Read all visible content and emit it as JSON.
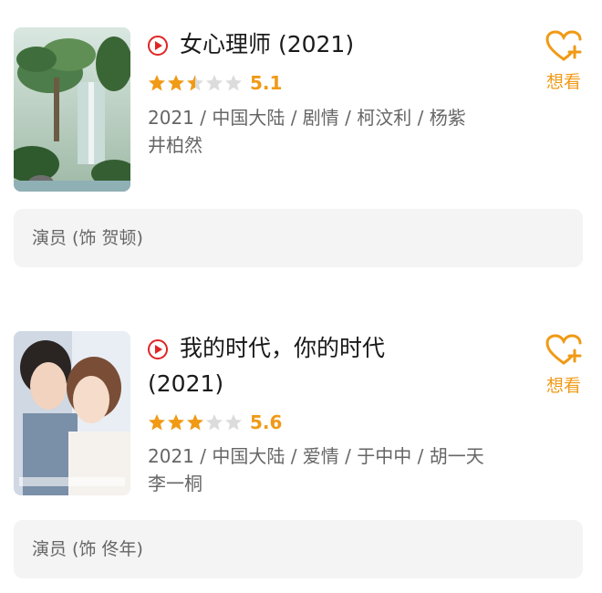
{
  "movies": [
    {
      "title": "女心理师 (2021)",
      "title_line2": "",
      "score": "5.1",
      "stars": 2.5,
      "meta": "2021 / 中国大陆 / 剧情 / 柯汶利 / 杨紫 井柏然",
      "want_label": "想看",
      "role": "演员 (饰 贺顿)",
      "poster_icon": "poster-tree-waterfall"
    },
    {
      "title": "我的时代，你的时代",
      "title_line2": "(2021)",
      "score": "5.6",
      "stars": 3,
      "meta": "2021 / 中国大陆 / 爱情 / 于中中 / 胡一天 李一桐",
      "want_label": "想看",
      "role": "演员 (饰 佟年)",
      "poster_icon": "poster-couple"
    }
  ],
  "colors": {
    "accent": "#f09a16",
    "play": "#e02424",
    "box": "#f4f4f4"
  }
}
